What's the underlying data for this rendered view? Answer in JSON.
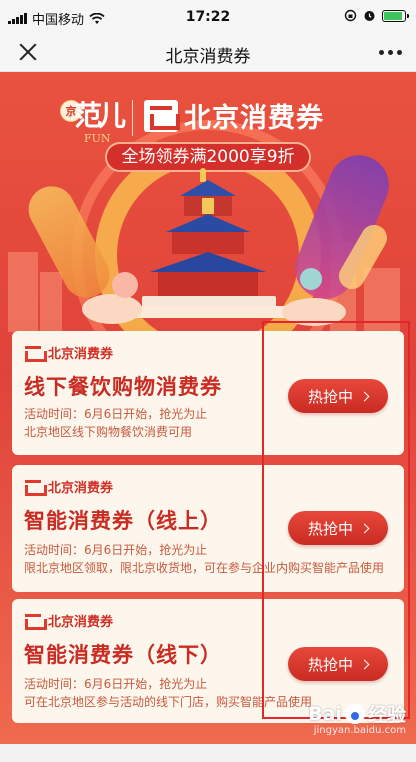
{
  "status_bar": {
    "carrier": "中国移动",
    "time": "17:22",
    "battery_level": 0.9
  },
  "nav": {
    "title": "北京消费券"
  },
  "banner": {
    "badge_char": "京",
    "script_title": "范儿",
    "fun_text": "FUN",
    "brand_title": "北京消费券",
    "promo": "全场领券满2000享9折"
  },
  "cards": [
    {
      "brand": "北京消费券",
      "title": "线下餐饮购物消费券",
      "desc_lines": [
        "活动时间：6月6日开始，抢光为止",
        "北京地区线下购物餐饮消费可用"
      ],
      "button": "热抢中"
    },
    {
      "brand": "北京消费券",
      "title": "智能消费券（线上）",
      "desc_lines": [
        "活动时间：6月6日开始，抢光为止",
        "限北京地区领取，限北京收货地，可在参与企业内购买智能产品使用"
      ],
      "button": "热抢中"
    },
    {
      "brand": "北京消费券",
      "title": "智能消费券（线下）",
      "desc_lines": [
        "活动时间：6月6日开始，抢光为止",
        "可在北京地区参与活动的线下门店，购买智能产品使用"
      ],
      "button": "热抢中"
    }
  ],
  "watermark": {
    "brand_a": "Bai",
    "brand_b": "经验",
    "url": "jingyan.baidu.com"
  },
  "colors": {
    "primary_red": "#e0433a",
    "card_bg": "#fdf6ed",
    "button_red": "#c92b22",
    "highlight": "#e4252a"
  }
}
